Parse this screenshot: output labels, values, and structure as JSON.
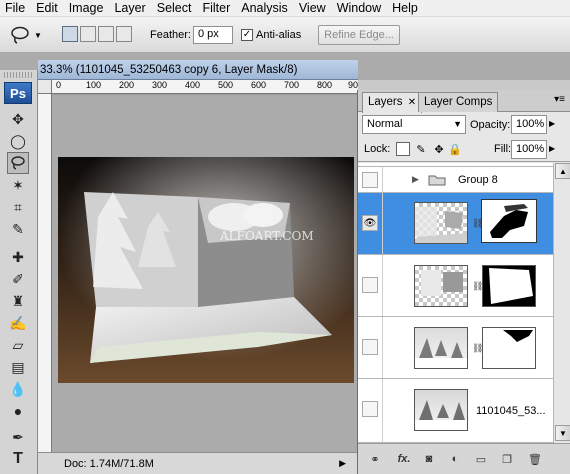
{
  "menubar": [
    "File",
    "Edit",
    "Image",
    "Layer",
    "Select",
    "Filter",
    "Analysis",
    "View",
    "Window",
    "Help"
  ],
  "options": {
    "feather_label": "Feather:",
    "feather_value": "0 px",
    "antialias_label": "Anti-alias",
    "antialias_checked": true,
    "refine_edge_label": "Refine Edge..."
  },
  "toolbox": {
    "logo": "Ps",
    "tools": [
      "move-tool",
      "elliptical-marquee-tool",
      "lasso-tool",
      "magic-wand-tool",
      "crop-tool",
      "eyedropper-tool",
      "spot-healing-brush-tool",
      "brush-tool",
      "clone-stamp-tool",
      "history-brush-tool",
      "eraser-tool",
      "gradient-tool",
      "blur-tool",
      "dodge-tool",
      "pen-tool",
      "type-tool"
    ],
    "selected_tool": "lasso-tool"
  },
  "document": {
    "title": "33.3% (1101045_53250463 copy 6, Layer Mask/8)",
    "ruler_ticks": [
      "0",
      "100",
      "200",
      "300",
      "400",
      "500",
      "600",
      "700",
      "800",
      "900"
    ],
    "status": "Doc: 1.74M/71.8M",
    "watermark": "ALFOART.COM"
  },
  "layers_panel": {
    "tabs": [
      "Layers",
      "Layer Comps"
    ],
    "active_tab": "Layers",
    "blend_mode": "Normal",
    "opacity_label": "Opacity:",
    "opacity_value": "100%",
    "lock_label": "Lock:",
    "fill_label": "Fill:",
    "fill_value": "100%",
    "group_name": "Group 8",
    "layers": [
      {
        "name": "",
        "selected": true,
        "visible": true
      },
      {
        "name": "",
        "selected": false,
        "visible": false
      },
      {
        "name": "",
        "selected": false,
        "visible": false
      },
      {
        "name": "1101045_53...",
        "selected": false,
        "visible": false
      }
    ],
    "footer_icons": [
      "link-layers-icon",
      "fx-icon",
      "add-mask-icon",
      "adjustment-layer-icon",
      "new-group-icon",
      "new-layer-icon",
      "delete-layer-icon"
    ],
    "fx_label": "fx."
  }
}
